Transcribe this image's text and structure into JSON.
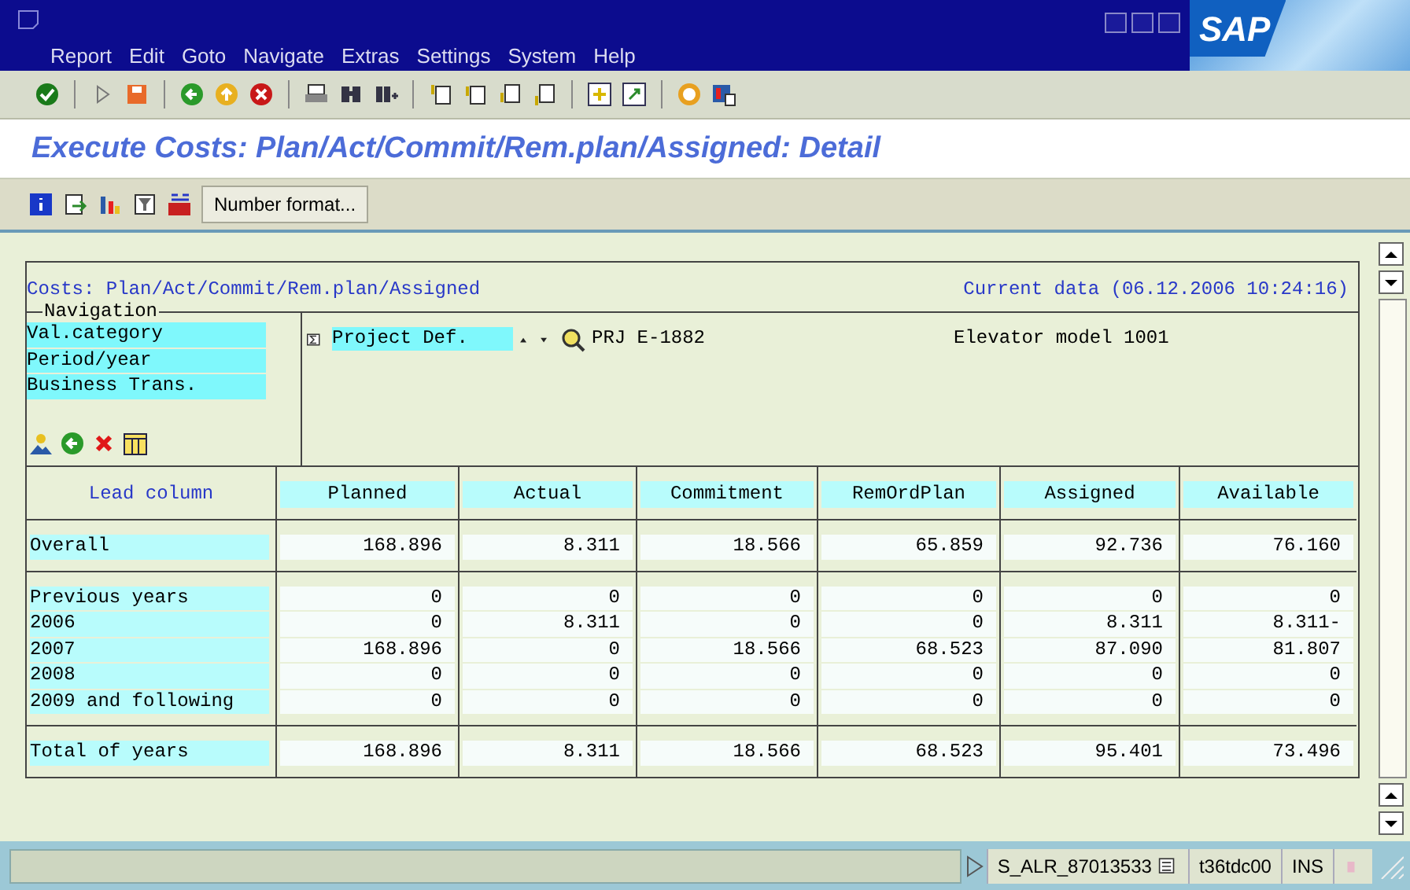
{
  "menu": [
    "Report",
    "Edit",
    "Goto",
    "Navigate",
    "Extras",
    "Settings",
    "System",
    "Help"
  ],
  "logo": "SAP",
  "title": "Execute Costs: Plan/Act/Commit/Rem.plan/Assigned: Detail",
  "app_toolbar": {
    "button": "Number format..."
  },
  "report": {
    "heading": "Costs: Plan/Act/Commit/Rem.plan/Assigned",
    "data_status": "Current data (06.12.2006 10:24:16)",
    "navigation": {
      "legend": "Navigation",
      "items": [
        "Val.category",
        "Period/year",
        "Business Trans."
      ]
    },
    "characteristic": {
      "label": "Project Def.",
      "value": "PRJ E-1882",
      "description": "Elevator model 1001"
    },
    "columns": [
      "Lead column",
      "Planned",
      "Actual",
      "Commitment",
      "RemOrdPlan",
      "Assigned",
      "Available"
    ],
    "sections": [
      [
        {
          "label": "Overall",
          "values": [
            "168.896",
            "8.311",
            "18.566",
            "65.859",
            "92.736",
            "76.160"
          ]
        }
      ],
      [
        {
          "label": "Previous years",
          "values": [
            "0",
            "0",
            "0",
            "0",
            "0",
            "0"
          ]
        },
        {
          "label": "2006",
          "values": [
            "0",
            "8.311",
            "0",
            "0",
            "8.311",
            "8.311-"
          ]
        },
        {
          "label": "2007",
          "values": [
            "168.896",
            "0",
            "18.566",
            "68.523",
            "87.090",
            "81.807"
          ]
        },
        {
          "label": "2008",
          "values": [
            "0",
            "0",
            "0",
            "0",
            "0",
            "0"
          ]
        },
        {
          "label": "2009 and following",
          "values": [
            "0",
            "0",
            "0",
            "0",
            "0",
            "0"
          ]
        }
      ],
      [
        {
          "label": "Total of years",
          "values": [
            "168.896",
            "8.311",
            "18.566",
            "68.523",
            "95.401",
            "73.496"
          ]
        }
      ]
    ]
  },
  "status_bar": {
    "transaction": "S_ALR_87013533",
    "server": "t36tdc00",
    "mode": "INS"
  }
}
